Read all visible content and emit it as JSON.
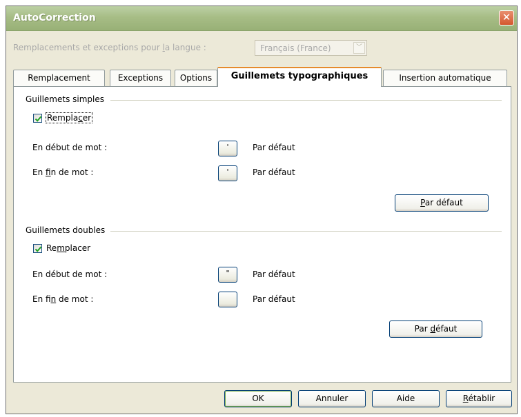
{
  "window": {
    "title": "AutoCorrection",
    "close_glyph": "✕"
  },
  "language": {
    "label_prefix": "Remplacements et exceptions pour ",
    "label_mnemonic": "l",
    "label_suffix": "a langue :",
    "selected": "Français (France)",
    "arrow_glyph": "﹀"
  },
  "tabs": [
    {
      "label": "Remplacement",
      "active": false
    },
    {
      "label": "Exceptions",
      "active": false
    },
    {
      "label": "Options",
      "active": false
    },
    {
      "label": "Guillemets typographiques",
      "active": true
    },
    {
      "label": "Insertion automatique",
      "active": false
    }
  ],
  "single_quotes": {
    "group_label": "Guillemets simples",
    "replace_prefix": "Rempla",
    "replace_mnemonic": "c",
    "replace_suffix": "er",
    "replace_checked": true,
    "start_label": "En début de mot :",
    "start_symbol": "'",
    "start_value": "Par défaut",
    "end_prefix": "En ",
    "end_mnemonic": "f",
    "end_suffix": "in de mot :",
    "end_symbol": "'",
    "end_value": "Par défaut",
    "default_mnemonic": "P",
    "default_suffix": "ar défaut"
  },
  "double_quotes": {
    "group_label": "Guillemets doubles",
    "replace_prefix": "Re",
    "replace_mnemonic": "m",
    "replace_suffix": "placer",
    "replace_checked": true,
    "start_label": "En début de mot :",
    "start_symbol": "\"",
    "start_value": "Par défaut",
    "end_prefix": "En fi",
    "end_mnemonic": "n",
    "end_suffix": " de mot :",
    "end_symbol": "",
    "end_value": "Par défaut",
    "default_prefix": "Par ",
    "default_mnemonic": "d",
    "default_suffix": "éfaut"
  },
  "footer": {
    "ok": "OK",
    "cancel": "Annuler",
    "help": "Aide",
    "reset_mnemonic": "R",
    "reset_suffix": "établir"
  }
}
